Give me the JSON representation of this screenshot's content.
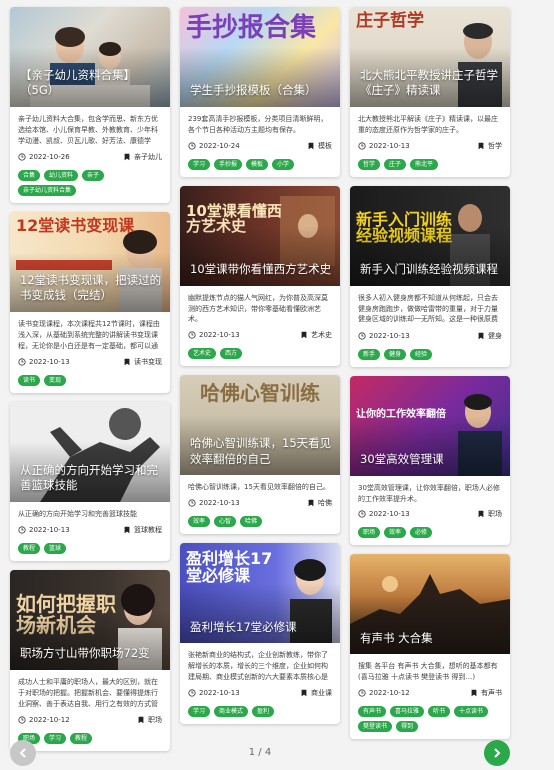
{
  "colors": {
    "tag_green": "#2aa84a",
    "prev_gray": "#c7c7c7"
  },
  "cards": [
    {
      "title": "【亲子幼儿资料合集】（5G）",
      "desc": "亲子幼儿资料大合集，包含学而思、新东方优选绘本馆、小儿保育早教、外教教育、少年科学动漫、凯叔、贝瓦儿歌、好芳法、康德学堂…",
      "date": "2022-10-26",
      "category": "亲子幼儿",
      "tags": [
        "合集",
        "幼儿资料",
        "亲子",
        "亲子幼儿资料合集"
      ]
    },
    {
      "title": "12堂读书变现课，把读过的书变成钱（完结）",
      "desc": "读书变现课程，本次课程共12节课时，课程由浅入深，从基础到系统完整的讲解读书变现课程，无论你是小白还是有一定基础，都可以通过学习…",
      "date": "2022-10-13",
      "category": "读书变现",
      "tags": [
        "读书",
        "变现"
      ],
      "art": "12堂读书变现课"
    },
    {
      "title": "从正确的方向开始学习和完善篮球技能",
      "desc": "从正确的方向开始学习和完善篮球技能",
      "date": "2022-10-13",
      "category": "篮球教程",
      "tags": [
        "教程",
        "篮球"
      ]
    },
    {
      "title": "职场方寸山带你职场72变",
      "desc": "成功人士和平庸的职场人，最大的区别，就在于对职场的把握。把握新机会、要懂得提炼行业洞察、善于表达自我、用行之有效的方式管理好…",
      "date": "2022-10-12",
      "category": "职场",
      "tags": [
        "职场",
        "学习",
        "教程"
      ],
      "art": "如何把握职场新机会"
    },
    {
      "title": "学生手抄报模板（合集）",
      "desc": "239套高清手抄报模板，分类项目清晰鲜明，各个节日各种活动方主题均有保存。",
      "date": "2022-10-24",
      "category": "模板",
      "tags": [
        "学习",
        "手抄报",
        "模板",
        "小学"
      ],
      "art": "手抄报合集"
    },
    {
      "title": "10堂课带你看懂西方艺术史",
      "desc": "幽默提炼节点的猫人气网红，为你普及高深莫测的西方艺术知识，带你零基础看懂欧洲艺术。",
      "date": "2022-10-13",
      "category": "艺术史",
      "tags": [
        "艺术史",
        "西方"
      ],
      "art": "10堂课看懂西方艺术史"
    },
    {
      "title": "哈佛心智训练课，15天看见效率翻倍的自己",
      "desc": "哈佛心智训练课，15天看见效率翻倍的自己。",
      "date": "2022-10-13",
      "category": "哈佛",
      "tags": [
        "效率",
        "心智",
        "哈佛"
      ],
      "art": "哈佛心智训练"
    },
    {
      "title": "盈利增长17堂必修课",
      "desc": "张艳新商业的结构式，企业创新教练，带你了解增长的本质，增长的三个维度，企业如何构建局期、商业模式创新的六大要素本质核心是什么…",
      "date": "2022-10-13",
      "category": "商业课",
      "tags": [
        "学习",
        "商业模式",
        "盈利"
      ],
      "art": "盈利增长17堂必修课"
    },
    {
      "title": "北大熊北平教授讲庄子哲学《庄子》精读课",
      "desc": "北大教授熊北平解读《庄子》精读课，以最庄重的态度还原作为哲学家的庄子。",
      "date": "2022-10-13",
      "category": "哲学",
      "tags": [
        "哲学",
        "庄子",
        "熊北平"
      ],
      "art": "庄子哲学"
    },
    {
      "title": "新手入门训练经验视频课程",
      "desc": "很多人初入健身房都不知道从何练起，只会去健身房跑跑步，做做哈雷带的重量，对于力量健身区域的训练却一无所知。这是一种很原费钱的做…",
      "date": "2022-10-13",
      "category": "健身",
      "tags": [
        "新手",
        "健身",
        "经验"
      ],
      "art": "新手入门训练经验视频课程"
    },
    {
      "title": "30堂高效管理课",
      "desc": "30堂高效管理课，让你效率翻倍，职场人必修的工作效率提升术。",
      "date": "2022-10-13",
      "category": "职场",
      "tags": [
        "职场",
        "效率",
        "必修"
      ],
      "art": "让你的工作效率翻倍"
    },
    {
      "title": "有声书 大合集",
      "desc": "搜集 各平台 有声书 大合集，想听的基本都有(喜马拉雅 十点读书 樊登读书 得到…)",
      "date": "2022-10-12",
      "category": "有声书",
      "tags": [
        "有声书",
        "喜马拉雅",
        "听书",
        "十点读书",
        "樊登读书",
        "得到"
      ]
    }
  ],
  "pager": {
    "label": "1 / 4"
  }
}
